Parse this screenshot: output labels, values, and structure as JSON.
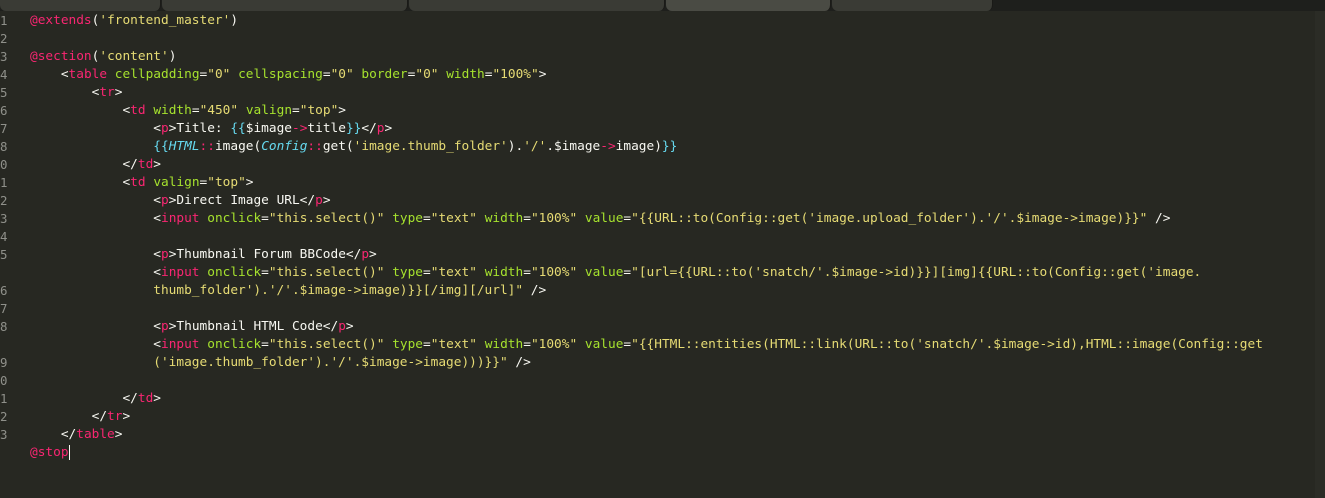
{
  "editor": {
    "theme_colors": {
      "background": "#272822",
      "keyword": "#f92672",
      "attribute": "#a6e22e",
      "string": "#e6db74",
      "class": "#66d9ef",
      "text": "#f8f8f2",
      "line_number": "#8f908a"
    },
    "line_numbers": [
      "1",
      "2",
      "3",
      "4",
      "5",
      "6",
      "7",
      "8",
      "9",
      "0",
      "1",
      "2",
      "3",
      "4",
      "5",
      "6",
      "7",
      "8",
      "9",
      "0",
      "1",
      "2",
      "3"
    ],
    "lines": [
      [
        [
          "t-at",
          "@extends"
        ],
        [
          "t-txt",
          "("
        ],
        [
          "t-str",
          "'frontend_master'"
        ],
        [
          "t-txt",
          ")"
        ]
      ],
      [],
      [
        [
          "t-at",
          "@section"
        ],
        [
          "t-txt",
          "("
        ],
        [
          "t-str",
          "'content'"
        ],
        [
          "t-txt",
          ")"
        ]
      ],
      [
        [
          "t-txt",
          "    <"
        ],
        [
          "t-tag",
          "table"
        ],
        [
          "t-txt",
          " "
        ],
        [
          "t-attr",
          "cellpadding"
        ],
        [
          "t-txt",
          "="
        ],
        [
          "t-str",
          "\"0\""
        ],
        [
          "t-txt",
          " "
        ],
        [
          "t-attr",
          "cellspacing"
        ],
        [
          "t-txt",
          "="
        ],
        [
          "t-str",
          "\"0\""
        ],
        [
          "t-txt",
          " "
        ],
        [
          "t-attr",
          "border"
        ],
        [
          "t-txt",
          "="
        ],
        [
          "t-str",
          "\"0\""
        ],
        [
          "t-txt",
          " "
        ],
        [
          "t-attr",
          "width"
        ],
        [
          "t-txt",
          "="
        ],
        [
          "t-str",
          "\"100%\""
        ],
        [
          "t-txt",
          ">"
        ]
      ],
      [
        [
          "t-txt",
          "        <"
        ],
        [
          "t-tag",
          "tr"
        ],
        [
          "t-txt",
          ">"
        ]
      ],
      [
        [
          "t-txt",
          "            <"
        ],
        [
          "t-tag",
          "td"
        ],
        [
          "t-txt",
          " "
        ],
        [
          "t-attr",
          "width"
        ],
        [
          "t-txt",
          "="
        ],
        [
          "t-str",
          "\"450\""
        ],
        [
          "t-txt",
          " "
        ],
        [
          "t-attr",
          "valign"
        ],
        [
          "t-txt",
          "="
        ],
        [
          "t-str",
          "\"top\""
        ],
        [
          "t-txt",
          ">"
        ]
      ],
      [
        [
          "t-txt",
          "                <"
        ],
        [
          "t-tag",
          "p"
        ],
        [
          "t-txt",
          ">Title: "
        ],
        [
          "t-brace",
          "{{"
        ],
        [
          "t-txt",
          "$image"
        ],
        [
          "t-op",
          "->"
        ],
        [
          "t-txt",
          "title"
        ],
        [
          "t-brace",
          "}}"
        ],
        [
          "t-txt",
          "</"
        ],
        [
          "t-tag",
          "p"
        ],
        [
          "t-txt",
          ">"
        ]
      ],
      [
        [
          "t-txt",
          "                "
        ],
        [
          "t-brace",
          "{{"
        ],
        [
          "t-cls",
          "HTML"
        ],
        [
          "t-op",
          "::"
        ],
        [
          "t-txt",
          "image("
        ],
        [
          "t-cls",
          "Config"
        ],
        [
          "t-op",
          "::"
        ],
        [
          "t-txt",
          "get("
        ],
        [
          "t-str",
          "'image.thumb_folder'"
        ],
        [
          "t-txt",
          ")."
        ],
        [
          "t-str",
          "'/'"
        ],
        [
          "t-txt",
          ".$image"
        ],
        [
          "t-op",
          "->"
        ],
        [
          "t-txt",
          "image)"
        ],
        [
          "t-brace",
          "}}"
        ]
      ],
      [
        [
          "t-txt",
          "            </"
        ],
        [
          "t-tag",
          "td"
        ],
        [
          "t-txt",
          ">"
        ]
      ],
      [
        [
          "t-txt",
          "            <"
        ],
        [
          "t-tag",
          "td"
        ],
        [
          "t-txt",
          " "
        ],
        [
          "t-attr",
          "valign"
        ],
        [
          "t-txt",
          "="
        ],
        [
          "t-str",
          "\"top\""
        ],
        [
          "t-txt",
          ">"
        ]
      ],
      [
        [
          "t-txt",
          "                <"
        ],
        [
          "t-tag",
          "p"
        ],
        [
          "t-txt",
          ">Direct Image URL</"
        ],
        [
          "t-tag",
          "p"
        ],
        [
          "t-txt",
          ">"
        ]
      ],
      [
        [
          "t-txt",
          "                <"
        ],
        [
          "t-tag",
          "input"
        ],
        [
          "t-txt",
          " "
        ],
        [
          "t-attr",
          "onclick"
        ],
        [
          "t-txt",
          "="
        ],
        [
          "t-str",
          "\"this.select()\""
        ],
        [
          "t-txt",
          " "
        ],
        [
          "t-attr",
          "type"
        ],
        [
          "t-txt",
          "="
        ],
        [
          "t-str",
          "\"text\""
        ],
        [
          "t-txt",
          " "
        ],
        [
          "t-attr",
          "width"
        ],
        [
          "t-txt",
          "="
        ],
        [
          "t-str",
          "\"100%\""
        ],
        [
          "t-txt",
          " "
        ],
        [
          "t-attr",
          "value"
        ],
        [
          "t-txt",
          "="
        ],
        [
          "t-str",
          "\"{{URL::to(Config::get('image.upload_folder').'/'.$image->image)}}\""
        ],
        [
          "t-txt",
          " />"
        ]
      ],
      [],
      [
        [
          "t-txt",
          "                <"
        ],
        [
          "t-tag",
          "p"
        ],
        [
          "t-txt",
          ">Thumbnail Forum BBCode</"
        ],
        [
          "t-tag",
          "p"
        ],
        [
          "t-txt",
          ">"
        ]
      ],
      [
        [
          "t-txt",
          "                <"
        ],
        [
          "t-tag",
          "input"
        ],
        [
          "t-txt",
          " "
        ],
        [
          "t-attr",
          "onclick"
        ],
        [
          "t-txt",
          "="
        ],
        [
          "t-str",
          "\"this.select()\""
        ],
        [
          "t-txt",
          " "
        ],
        [
          "t-attr",
          "type"
        ],
        [
          "t-txt",
          "="
        ],
        [
          "t-str",
          "\"text\""
        ],
        [
          "t-txt",
          " "
        ],
        [
          "t-attr",
          "width"
        ],
        [
          "t-txt",
          "="
        ],
        [
          "t-str",
          "\"100%\""
        ],
        [
          "t-txt",
          " "
        ],
        [
          "t-attr",
          "value"
        ],
        [
          "t-txt",
          "="
        ],
        [
          "t-str",
          "\"[url={{URL::to('snatch/'.$image->id)}}][img]{{URL::to(Config::get('image."
        ]
      ],
      [
        [
          "t-str",
          "                thumb_folder').'/'.$image->image)}}[/img][/url]\""
        ],
        [
          "t-txt",
          " />"
        ]
      ],
      [],
      [
        [
          "t-txt",
          "                <"
        ],
        [
          "t-tag",
          "p"
        ],
        [
          "t-txt",
          ">Thumbnail HTML Code</"
        ],
        [
          "t-tag",
          "p"
        ],
        [
          "t-txt",
          ">"
        ]
      ],
      [
        [
          "t-txt",
          "                <"
        ],
        [
          "t-tag",
          "input"
        ],
        [
          "t-txt",
          " "
        ],
        [
          "t-attr",
          "onclick"
        ],
        [
          "t-txt",
          "="
        ],
        [
          "t-str",
          "\"this.select()\""
        ],
        [
          "t-txt",
          " "
        ],
        [
          "t-attr",
          "type"
        ],
        [
          "t-txt",
          "="
        ],
        [
          "t-str",
          "\"text\""
        ],
        [
          "t-txt",
          " "
        ],
        [
          "t-attr",
          "width"
        ],
        [
          "t-txt",
          "="
        ],
        [
          "t-str",
          "\"100%\""
        ],
        [
          "t-txt",
          " "
        ],
        [
          "t-attr",
          "value"
        ],
        [
          "t-txt",
          "="
        ],
        [
          "t-str",
          "\"{{HTML::entities(HTML::link(URL::to('snatch/'.$image->id),HTML::image(Config::get"
        ]
      ],
      [
        [
          "t-str",
          "                ('image.thumb_folder').'/'.$image->image)))}}\""
        ],
        [
          "t-txt",
          " />"
        ]
      ],
      [],
      [
        [
          "t-txt",
          "            </"
        ],
        [
          "t-tag",
          "td"
        ],
        [
          "t-txt",
          ">"
        ]
      ],
      [
        [
          "t-txt",
          "        </"
        ],
        [
          "t-tag",
          "tr"
        ],
        [
          "t-txt",
          ">"
        ]
      ],
      [
        [
          "t-txt",
          "    </"
        ],
        [
          "t-tag",
          "table"
        ],
        [
          "t-txt",
          ">"
        ]
      ],
      [
        [
          "t-at",
          "@stop"
        ],
        [
          "cursor",
          ""
        ]
      ]
    ],
    "gutter_labels": [
      "1",
      "2",
      "3",
      "4",
      "5",
      "6",
      "7",
      "8",
      "0",
      "1",
      "2",
      "3",
      "4",
      "5",
      "",
      "6",
      "7",
      "8",
      "",
      "9",
      "0",
      "1",
      "2",
      "3"
    ]
  }
}
